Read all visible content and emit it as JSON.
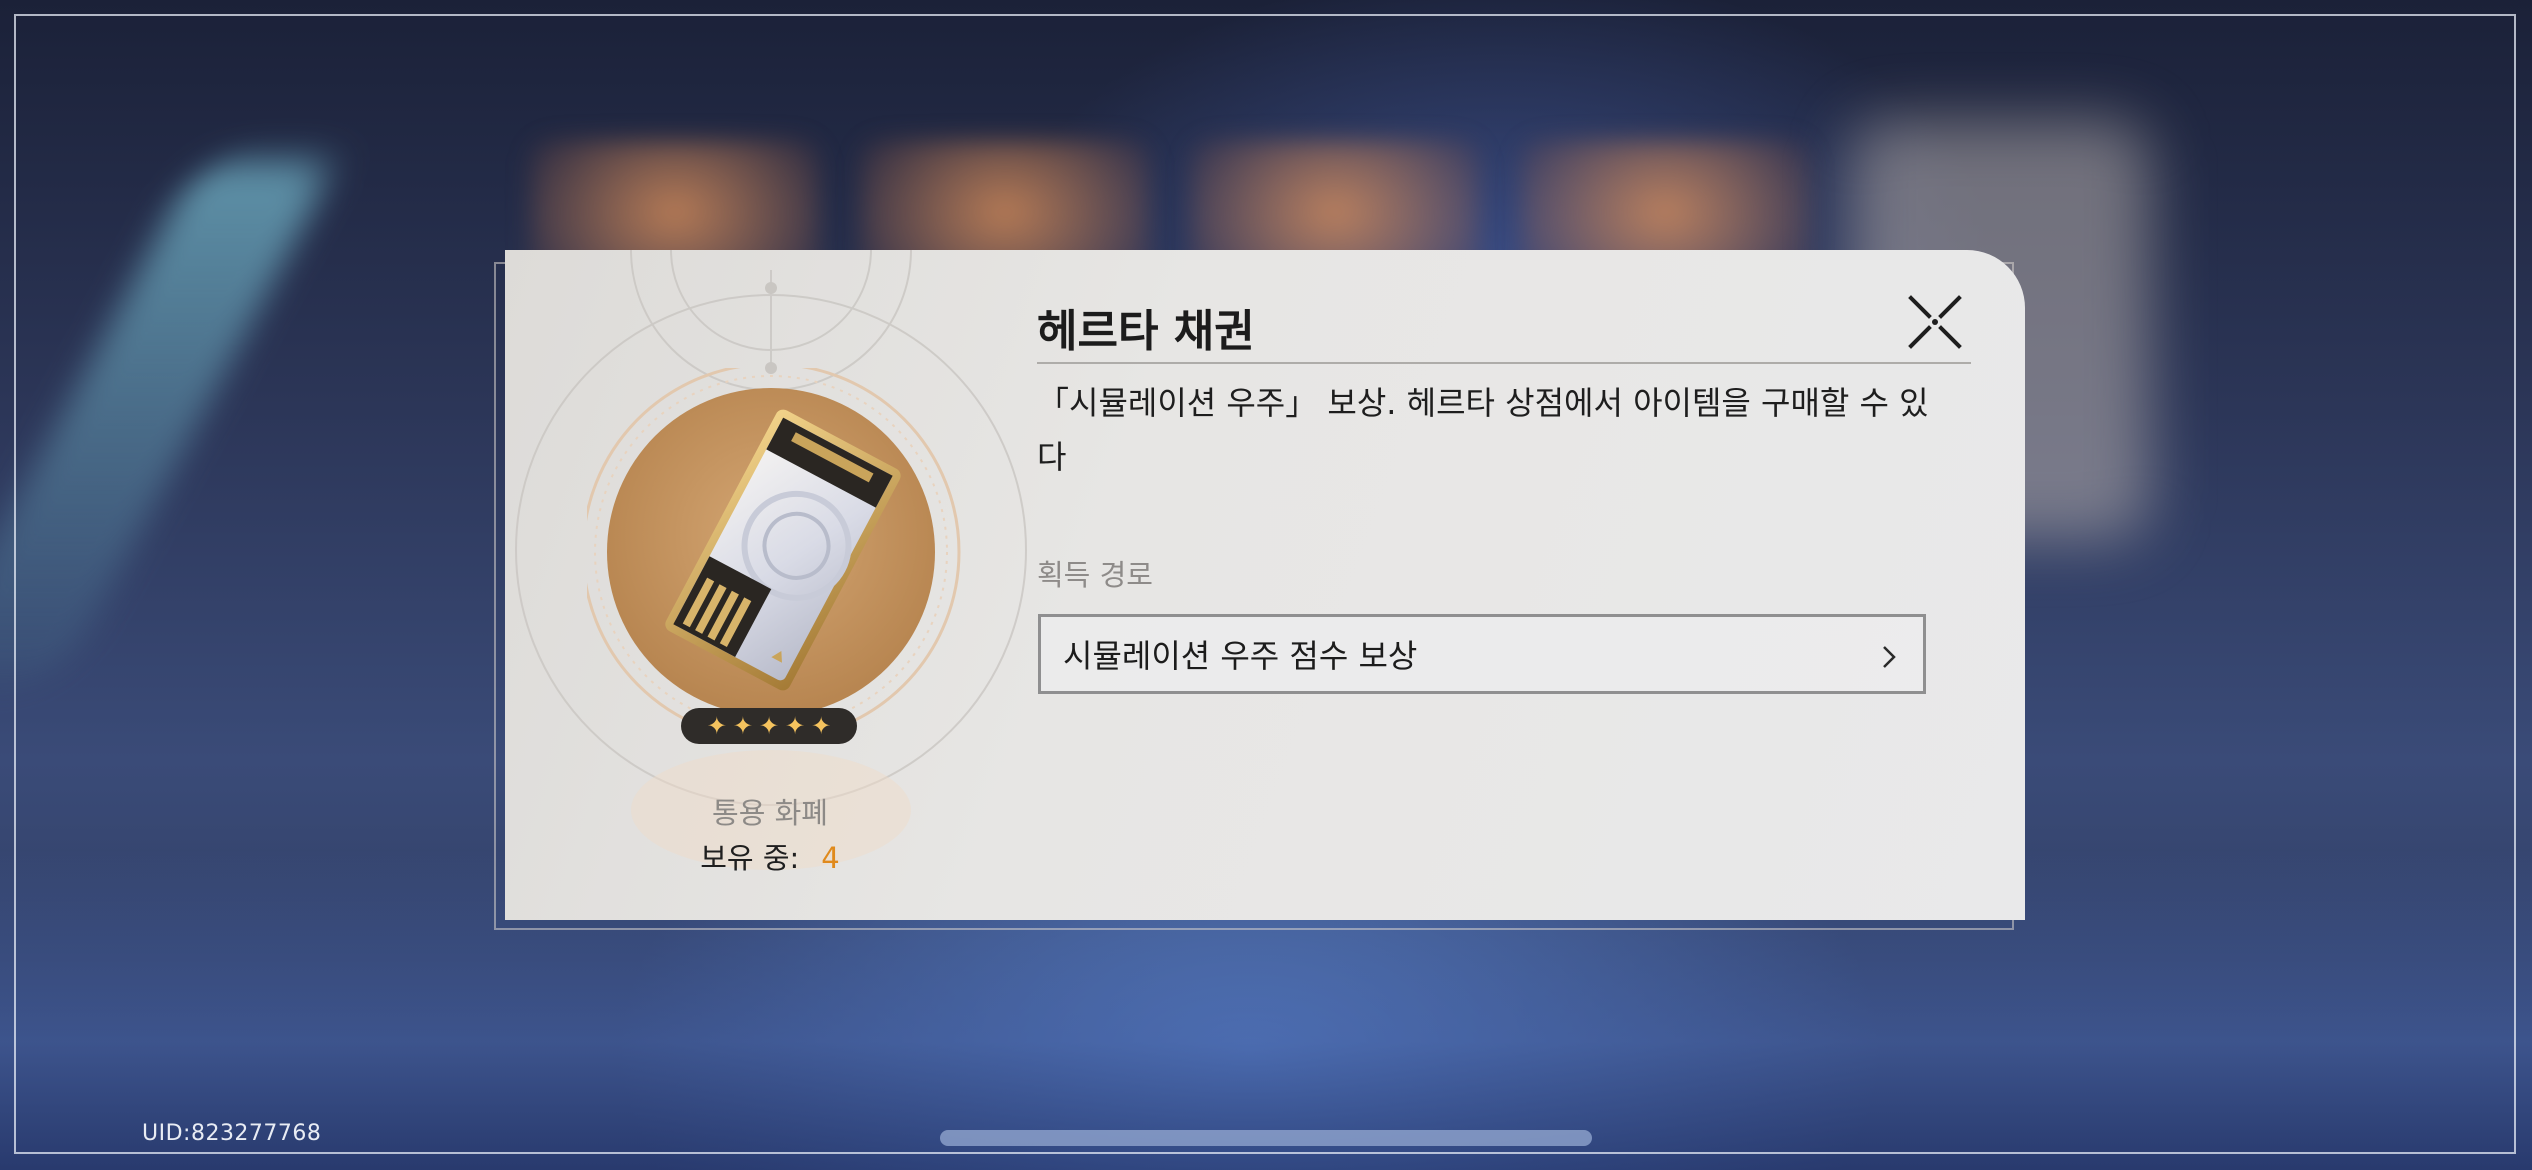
{
  "item": {
    "name": "헤르타 채권",
    "description": "「시뮬레이션 우주」 보상. 헤르타 상점에서 아이템을 구매할 수 있다",
    "rarity_stars": 5,
    "category": "통용 화폐",
    "owned_label": "보유 중:",
    "owned_count": "4"
  },
  "acquisition": {
    "label": "획득 경로",
    "sources": [
      "시뮬레이션 우주 점수 보상"
    ]
  },
  "footer": {
    "uid": "UID:823277768"
  },
  "icons": {
    "close": "close-x-icon",
    "source_arrow": "chevron-right-icon",
    "star": "star-icon"
  },
  "colors": {
    "owned_count": "#e08a1c",
    "star": "#f5c35e"
  }
}
